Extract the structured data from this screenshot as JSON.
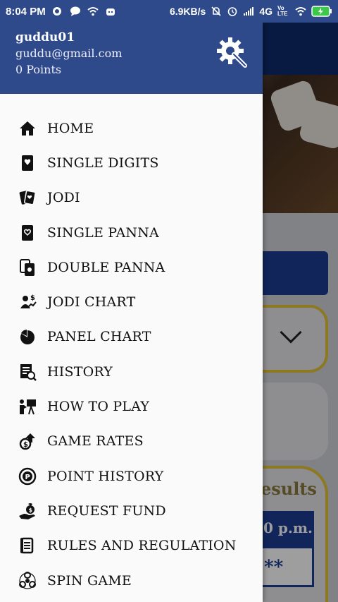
{
  "status_bar": {
    "time": "8:04 PM",
    "speed": "6.9KB/s",
    "network": "4G",
    "volte": "Vo LTE"
  },
  "background_screen": {
    "results_text": "esults",
    "time_text": "0 p.m.",
    "stars_text": "**"
  },
  "drawer": {
    "username": "guddu01",
    "email": "guddu@gmail.com",
    "points": "0 Points",
    "menu": [
      {
        "label": "HOME",
        "icon": "home-icon"
      },
      {
        "label": "SINGLE DIGITS",
        "icon": "card-icon"
      },
      {
        "label": "JODI",
        "icon": "cards-icon"
      },
      {
        "label": "SINGLE PANNA",
        "icon": "heart-card-icon"
      },
      {
        "label": "DOUBLE PANNA",
        "icon": "double-card-icon"
      },
      {
        "label": "JODI CHART",
        "icon": "money-chart-icon"
      },
      {
        "label": "PANEL CHART",
        "icon": "pie-chart-icon"
      },
      {
        "label": "HISTORY",
        "icon": "history-icon"
      },
      {
        "label": "HOW TO PLAY",
        "icon": "presentation-icon"
      },
      {
        "label": "GAME RATES",
        "icon": "money-up-icon"
      },
      {
        "label": "POINT HISTORY",
        "icon": "point-icon"
      },
      {
        "label": "REQUEST FUND",
        "icon": "fund-icon"
      },
      {
        "label": "RULES AND REGULATION",
        "icon": "rules-icon"
      },
      {
        "label": "SPIN GAME",
        "icon": "spinner-icon"
      }
    ]
  }
}
